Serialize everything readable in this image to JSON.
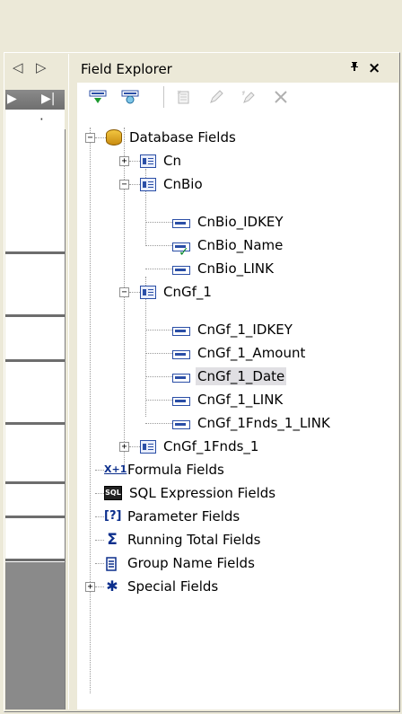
{
  "left_pane": {
    "prev_arrow": "◁",
    "next_arrow": "▷",
    "toolbar_play": "▶",
    "toolbar_last": "▶|",
    "ruler_dots": "· ·"
  },
  "explorer": {
    "title": "Field Explorer",
    "pin_glyph": "ᵖ",
    "close_glyph": "×",
    "tree": {
      "database_fields": "Database Fields",
      "cn": "Cn",
      "cnbio": "CnBio",
      "cnbio_fields": [
        "CnBio_IDKEY",
        "CnBio_Name",
        "CnBio_LINK"
      ],
      "cngf_1": "CnGf_1",
      "cngf_1_fields": [
        "CnGf_1_IDKEY",
        "CnGf_1_Amount",
        "CnGf_1_Date",
        "CnGf_1_LINK",
        "CnGf_1Fnds_1_LINK"
      ],
      "cngf_1fnds_1": "CnGf_1Fnds_1",
      "formula_fields": "Formula Fields",
      "sql_expression_fields": "SQL Expression Fields",
      "parameter_fields": "Parameter Fields",
      "running_total_fields": "Running Total Fields",
      "group_name_fields": "Group Name Fields",
      "special_fields": "Special Fields"
    },
    "icons": {
      "formula": "X+1",
      "sql": "SQL",
      "parameter": "[?]",
      "running_total": "Σ",
      "special": "✱"
    }
  },
  "colors": {
    "panel_bg": "#ece9d8",
    "selection_bg": "#e0dfe3",
    "icon_blue": "#2a4ea6"
  }
}
